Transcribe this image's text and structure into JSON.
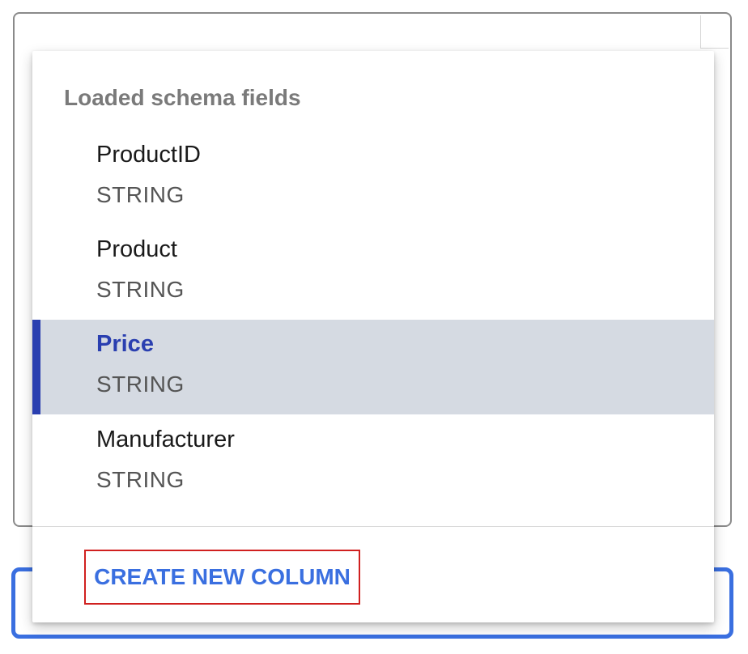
{
  "dropdown": {
    "section_header": "Loaded schema fields",
    "options": [
      {
        "name": "ProductID",
        "type": "STRING",
        "selected": false
      },
      {
        "name": "Product",
        "type": "STRING",
        "selected": false
      },
      {
        "name": "Price",
        "type": "STRING",
        "selected": true
      },
      {
        "name": "Manufacturer",
        "type": "STRING",
        "selected": false
      }
    ],
    "create_label": "CREATE NEW COLUMN"
  },
  "colors": {
    "accent": "#3a6fe0",
    "selected_text": "#2a3fb0",
    "selected_bg": "#d5dae2",
    "highlight_outline": "#d0201f"
  }
}
